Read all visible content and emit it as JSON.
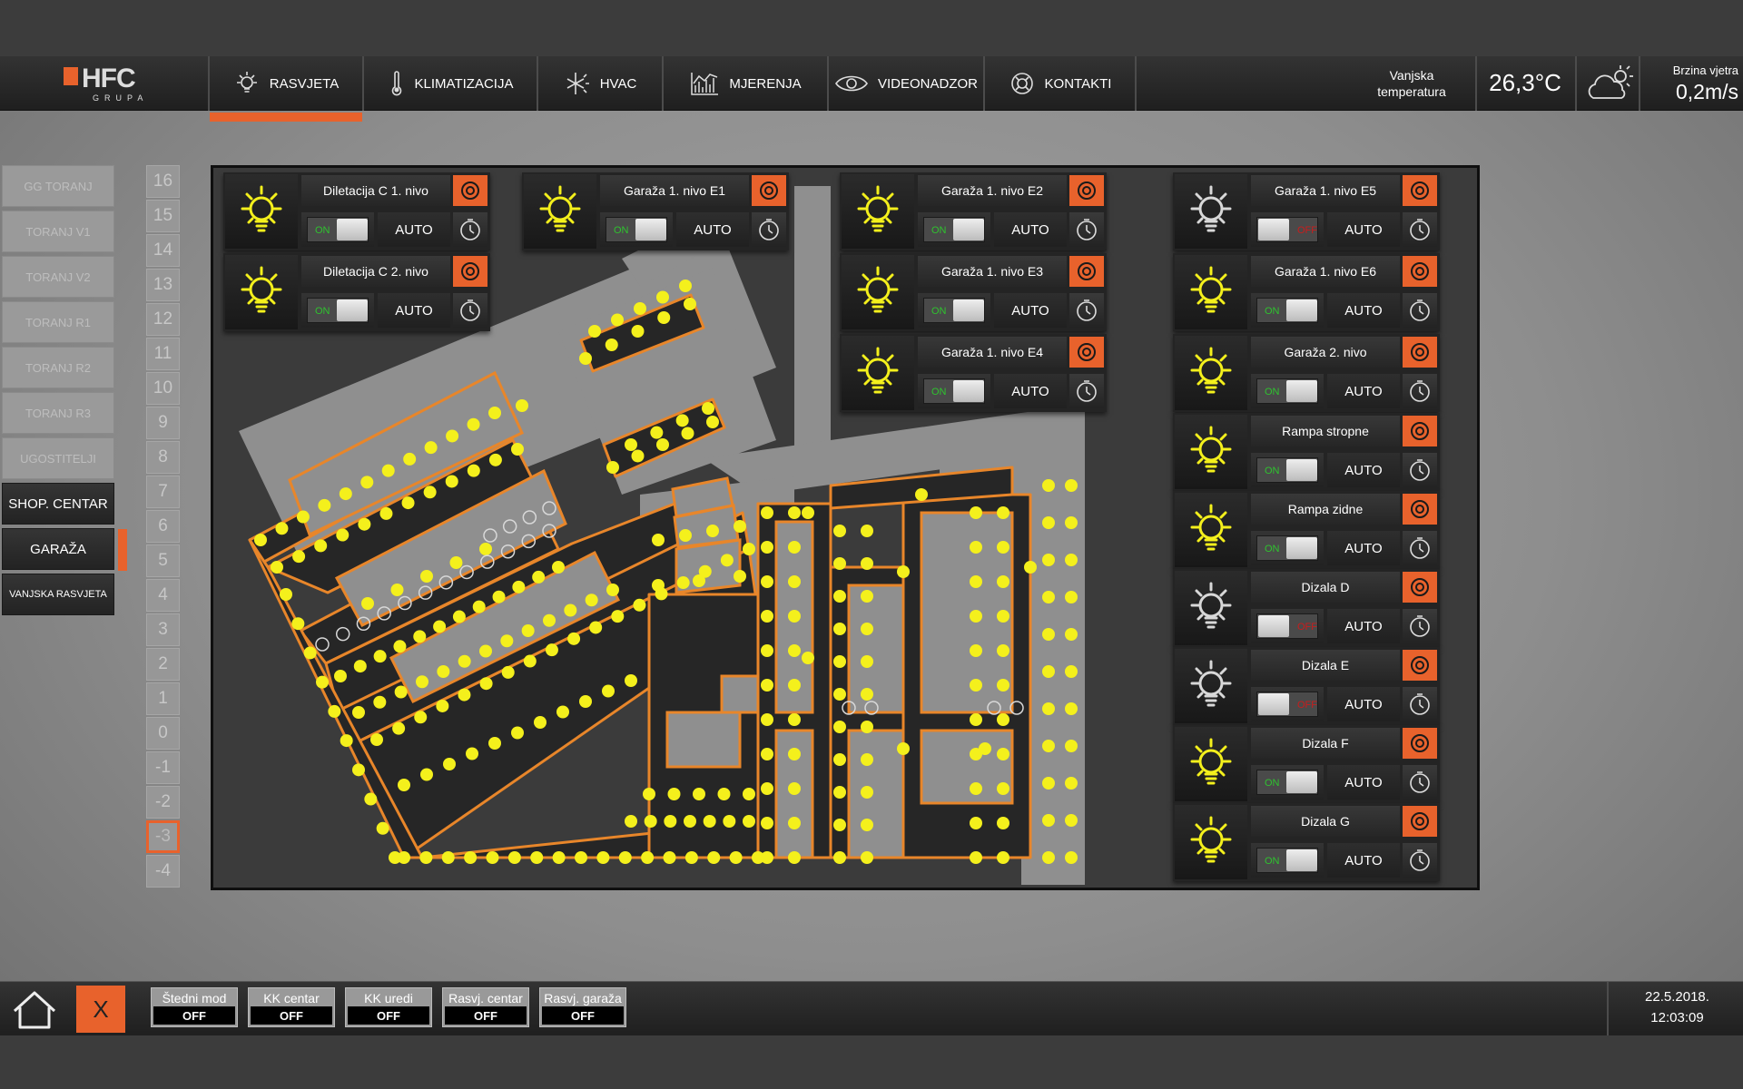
{
  "logo": {
    "text": "HFC",
    "subtitle": "GRUPA"
  },
  "nav": {
    "tabs": [
      {
        "label": "RASVJETA",
        "icon": "bulb-icon",
        "active": true
      },
      {
        "label": "KLIMATIZACIJA",
        "icon": "thermometer-icon"
      },
      {
        "label": "HVAC",
        "icon": "snowflake-sun-icon"
      },
      {
        "label": "MJERENJA",
        "icon": "chart-icon"
      },
      {
        "label": "VIDEONADZOR",
        "icon": "eye-icon"
      },
      {
        "label": "KONTAKTI",
        "icon": "lifebuoy-icon"
      }
    ]
  },
  "weather": {
    "temp_label": "Vanjska temperatura",
    "temp_value": "26,3°C",
    "icon": "cloud-sun-icon",
    "wind_label": "Brzina vjetra",
    "wind_value": "0,2m/s"
  },
  "buildings": [
    "GG TORANJ",
    "TORANJ V1",
    "TORANJ V2",
    "TORANJ R1",
    "TORANJ R2",
    "TORANJ R3",
    "UGOSTITELJI",
    "SHOP. CENTAR",
    "GARAŽA",
    "VANJSKA RASVJETA"
  ],
  "active_buildings": [
    "SHOP. CENTAR",
    "GARAŽA",
    "VANJSKA RASVJETA"
  ],
  "selected_building": "GARAŽA",
  "floors": [
    "16",
    "15",
    "14",
    "13",
    "12",
    "11",
    "10",
    "9",
    "8",
    "7",
    "6",
    "5",
    "4",
    "3",
    "2",
    "1",
    "0",
    "-1",
    "-2",
    "-3",
    "-4"
  ],
  "selected_floor": "-3",
  "toggle_on_label": "ON",
  "toggle_off_label": "OFF",
  "auto_label": "AUTO",
  "lights": [
    {
      "name": "Diletacija C 1. nivo",
      "on": true
    },
    {
      "name": "Diletacija C 2. nivo",
      "on": true
    },
    {
      "name": "Garaža 1. nivo E1",
      "on": true
    },
    {
      "name": "Garaža 1. nivo E2",
      "on": true
    },
    {
      "name": "Garaža 1. nivo E3",
      "on": true
    },
    {
      "name": "Garaža 1. nivo E4",
      "on": true
    },
    {
      "name": "Garaža 1. nivo E5",
      "on": false
    },
    {
      "name": "Garaža 1. nivo E6",
      "on": true
    },
    {
      "name": "Garaža 2. nivo",
      "on": true
    },
    {
      "name": "Rampa stropne",
      "on": true
    },
    {
      "name": "Rampa zidne",
      "on": true
    },
    {
      "name": "Dizala D",
      "on": false
    },
    {
      "name": "Dizala E",
      "on": false
    },
    {
      "name": "Dizala F",
      "on": true
    },
    {
      "name": "Dizala G",
      "on": true
    }
  ],
  "footer": {
    "close_label": "X",
    "modes": [
      {
        "label": "Štedni mod",
        "value": "OFF"
      },
      {
        "label": "KK centar",
        "value": "OFF"
      },
      {
        "label": "KK uredi",
        "value": "OFF"
      },
      {
        "label": "Rasvj. centar",
        "value": "OFF"
      },
      {
        "label": "Rasvj. garaža",
        "value": "OFF"
      }
    ],
    "date": "22.5.2018.",
    "time": "12:03:09"
  },
  "colors": {
    "accent": "#e8622c",
    "lamp_on": "#f4f01c",
    "lamp_off": "#d8d8d8",
    "toggle_on": "#2fc22f",
    "toggle_off": "#c91c1c"
  }
}
